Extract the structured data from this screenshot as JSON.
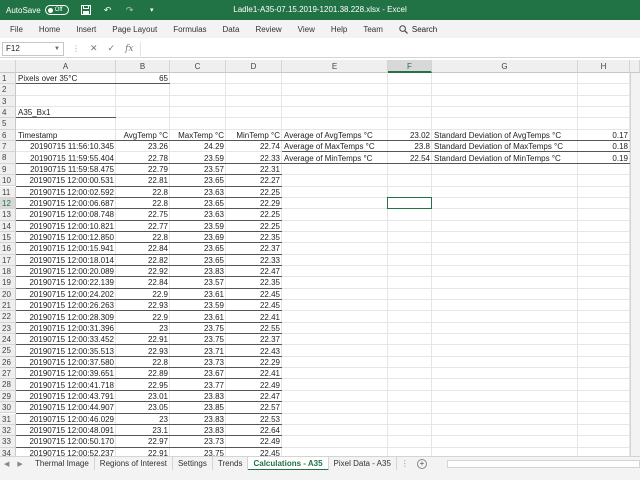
{
  "window": {
    "autosave_label": "AutoSave",
    "autosave_state": "Off",
    "title": "Ladle1-A35-07.15.2019-1201.38.228.xlsx  -  Excel"
  },
  "ribbon": {
    "tabs": [
      "File",
      "Home",
      "Insert",
      "Page Layout",
      "Formulas",
      "Data",
      "Review",
      "View",
      "Help",
      "Team"
    ],
    "search_label": "Search"
  },
  "formula_bar": {
    "name_box": "F12",
    "cancel": "✕",
    "enter": "✓",
    "fx": "fx"
  },
  "columns": [
    "A",
    "B",
    "C",
    "D",
    "E",
    "F",
    "G",
    "H"
  ],
  "row_numbers": [
    1,
    2,
    3,
    4,
    5,
    6,
    7,
    8,
    9,
    10,
    11,
    12,
    13,
    14,
    15,
    16,
    17,
    18,
    19,
    20,
    21,
    22,
    23,
    24,
    25,
    26,
    27,
    28,
    29,
    30,
    31,
    32,
    33,
    34
  ],
  "cells": {
    "a1": "Pixels over 35°C",
    "b1": "65",
    "a4": "A35_Bx1",
    "headers": [
      "Timestamp",
      "AvgTemp °C",
      "MaxTemp °C",
      "MinTemp °C"
    ],
    "stats_left": [
      {
        "label": "Average of AvgTemps °C",
        "value": "23.02"
      },
      {
        "label": "Average of MaxTemps °C",
        "value": "23.8"
      },
      {
        "label": "Average of MinTemps °C",
        "value": "22.54"
      }
    ],
    "stats_right": [
      {
        "label": "Standard Deviation of AvgTemps °C",
        "value": "0.17"
      },
      {
        "label": "Standard Deviation of MaxTemps °C",
        "value": "0.18"
      },
      {
        "label": "Standard Deviation of MinTemps °C",
        "value": "0.19"
      }
    ]
  },
  "data_rows": [
    [
      "20190715 11:56:10.345",
      "23.26",
      "24.29",
      "22.74"
    ],
    [
      "20190715 11:59:55.404",
      "22.78",
      "23.59",
      "22.33"
    ],
    [
      "20190715 11:59:58.475",
      "22.79",
      "23.57",
      "22.31"
    ],
    [
      "20190715 12:00:00.531",
      "22.81",
      "23.65",
      "22.27"
    ],
    [
      "20190715 12:00:02.592",
      "22.8",
      "23.63",
      "22.25"
    ],
    [
      "20190715 12:00:06.687",
      "22.8",
      "23.65",
      "22.29"
    ],
    [
      "20190715 12:00:08.748",
      "22.75",
      "23.63",
      "22.25"
    ],
    [
      "20190715 12:00:10.821",
      "22.77",
      "23.59",
      "22.25"
    ],
    [
      "20190715 12:00:12.850",
      "22.8",
      "23.69",
      "22.35"
    ],
    [
      "20190715 12:00:15.941",
      "22.84",
      "23.65",
      "22.37"
    ],
    [
      "20190715 12:00:18.014",
      "22.82",
      "23.65",
      "22.33"
    ],
    [
      "20190715 12:00:20.089",
      "22.92",
      "23.83",
      "22.47"
    ],
    [
      "20190715 12:00:22.139",
      "22.84",
      "23.57",
      "22.35"
    ],
    [
      "20190715 12:00:24.202",
      "22.9",
      "23.61",
      "22.45"
    ],
    [
      "20190715 12:00:26.263",
      "22.93",
      "23.59",
      "22.45"
    ],
    [
      "20190715 12:00:28.309",
      "22.9",
      "23.61",
      "22.41"
    ],
    [
      "20190715 12:00:31.396",
      "23",
      "23.75",
      "22.55"
    ],
    [
      "20190715 12:00:33.452",
      "22.91",
      "23.75",
      "22.37"
    ],
    [
      "20190715 12:00:35.513",
      "22.93",
      "23.71",
      "22.43"
    ],
    [
      "20190715 12:00:37.580",
      "22.8",
      "23.73",
      "22.29"
    ],
    [
      "20190715 12:00:39.651",
      "22.89",
      "23.67",
      "22.41"
    ],
    [
      "20190715 12:00:41.718",
      "22.95",
      "23.77",
      "22.49"
    ],
    [
      "20190715 12:00:43.791",
      "23.01",
      "23.83",
      "22.47"
    ],
    [
      "20190715 12:00:44.907",
      "23.05",
      "23.85",
      "22.57"
    ],
    [
      "20190715 12:00:46.029",
      "23",
      "23.83",
      "22.53"
    ],
    [
      "20190715 12:00:48.091",
      "23.1",
      "23.83",
      "22.64"
    ],
    [
      "20190715 12:00:50.170",
      "22.97",
      "23.73",
      "22.49"
    ],
    [
      "20190715 12:00:52.237",
      "22.91",
      "23.75",
      "22.45"
    ]
  ],
  "sheet_tabs": [
    "Thermal Image",
    "Regions of Interest",
    "Settings",
    "Trends",
    "Calculations - A35",
    "Pixel Data - A35"
  ],
  "active_sheet": "Calculations - A35",
  "colors": {
    "excel_green": "#217346"
  }
}
